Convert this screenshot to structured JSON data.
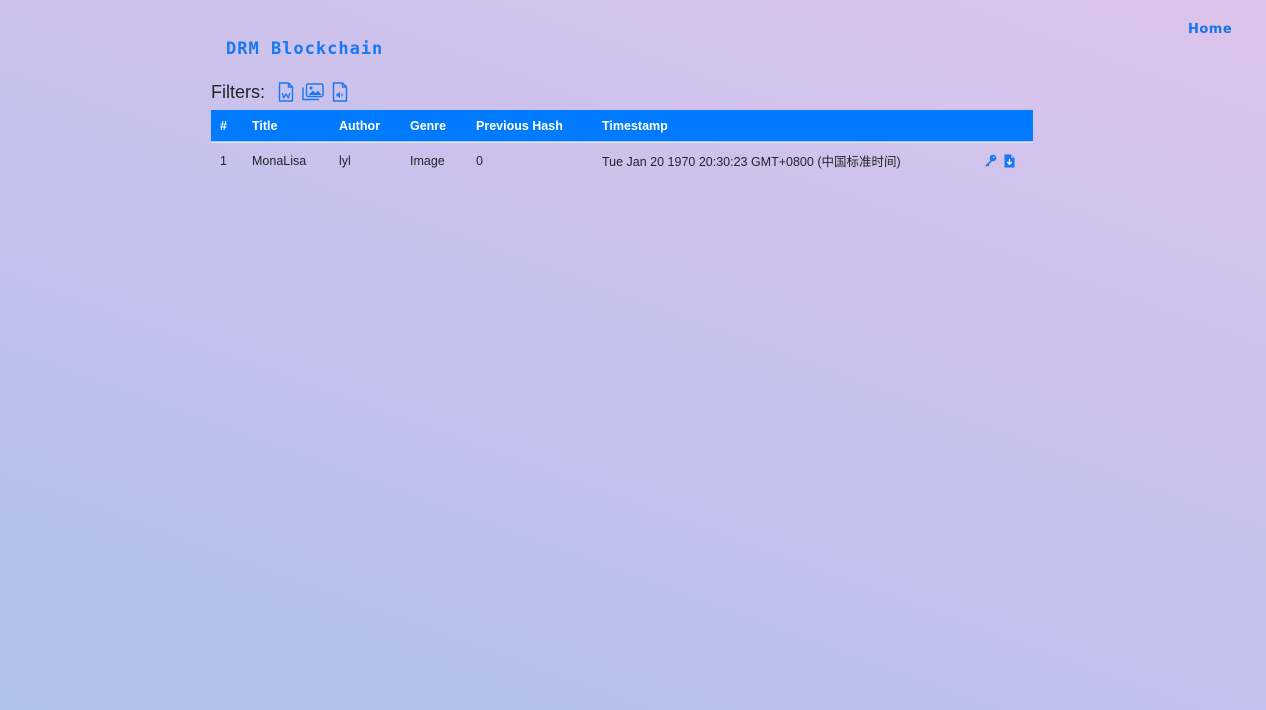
{
  "nav": {
    "home_label": "Home"
  },
  "brand": {
    "title": "DRM Blockchain"
  },
  "filters": {
    "label": "Filters:",
    "buttons": [
      {
        "icon": "word-document-icon"
      },
      {
        "icon": "images-icon"
      },
      {
        "icon": "audio-file-icon"
      }
    ]
  },
  "table": {
    "headers": [
      "#",
      "Title",
      "Author",
      "Genre",
      "Previous Hash",
      "Timestamp",
      ""
    ],
    "rows": [
      {
        "index": "1",
        "title": "MonaLisa",
        "author": "lyl",
        "genre": "Image",
        "previous_hash": "0",
        "timestamp": "Tue Jan 20 1970 20:30:23 GMT+0800 (中国标准时间)",
        "actions": [
          "key-icon",
          "file-download-icon"
        ]
      }
    ]
  },
  "colors": {
    "accent": "#007bff",
    "link": "#1a73e8"
  }
}
